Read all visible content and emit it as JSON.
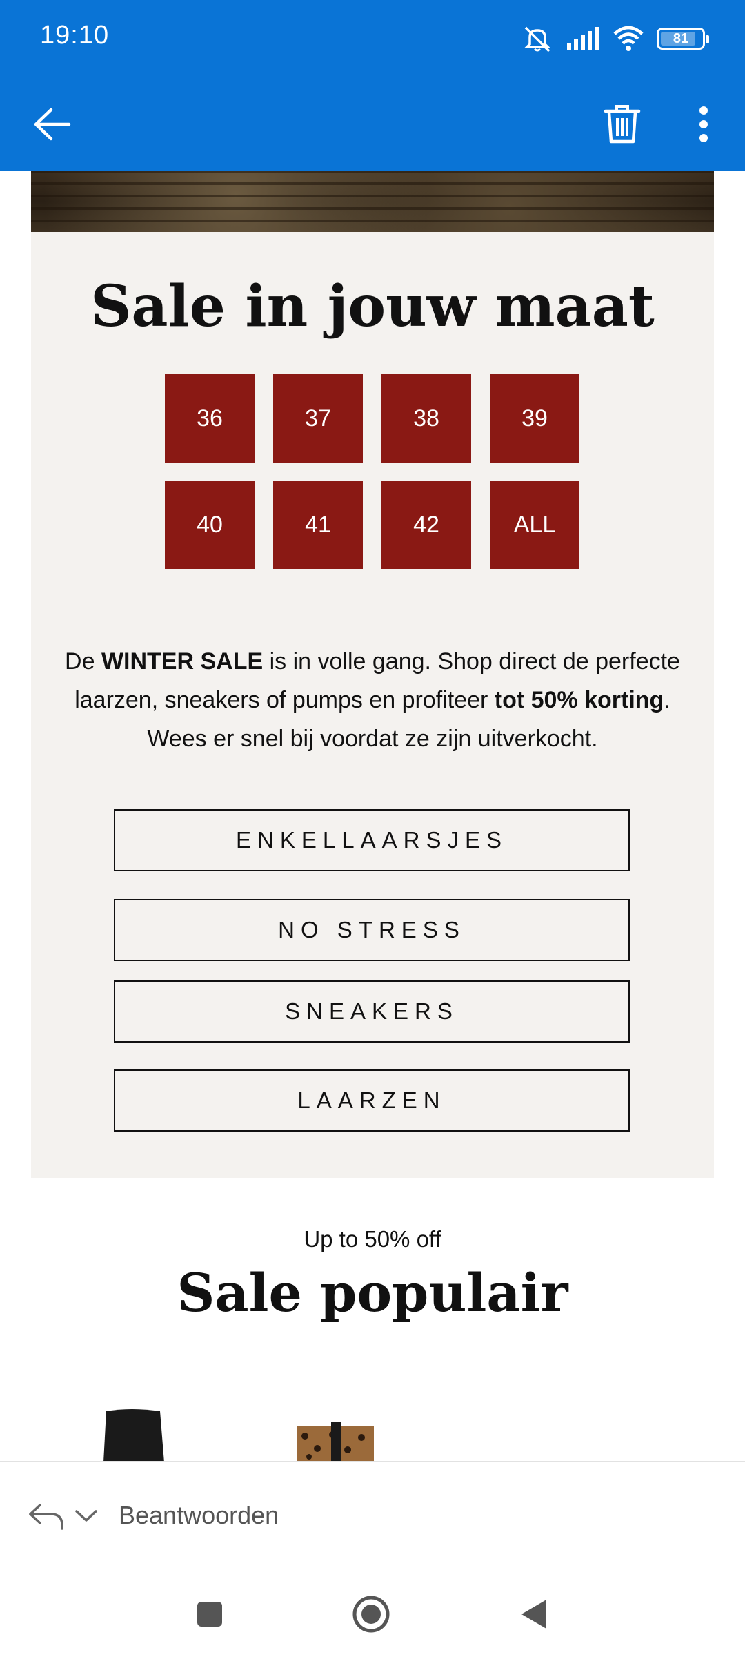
{
  "status_bar": {
    "time": "19:10",
    "battery": "81"
  },
  "app_bar": {
    "back_icon": "arrow-left-icon",
    "delete_icon": "trash-icon",
    "more_icon": "more-vertical-icon",
    "accent": "#0a74d6"
  },
  "email": {
    "sale_title": "Sale in jouw maat",
    "sizes": [
      "36",
      "37",
      "38",
      "39",
      "40",
      "41",
      "42",
      "ALL"
    ],
    "size_color": "#8a1914",
    "promo": {
      "p1": "De ",
      "b1": "WINTER SALE",
      "p2": " is in volle gang. Shop direct de perfecte laarzen, sneakers of pumps en profiteer ",
      "b2": "tot 50% korting",
      "p3": ". Wees er snel bij voordat ze zijn uitverkocht."
    },
    "categories": [
      "ENKELLAARSJES",
      "NO STRESS",
      "SNEAKERS",
      "LAARZEN"
    ],
    "subheading": "Up to 50% off",
    "popular_title": "Sale populair"
  },
  "reply_bar": {
    "label": "Beantwoorden"
  },
  "nav_bar": {
    "icons": [
      "square-icon",
      "home-circle-icon",
      "back-triangle-icon"
    ]
  }
}
